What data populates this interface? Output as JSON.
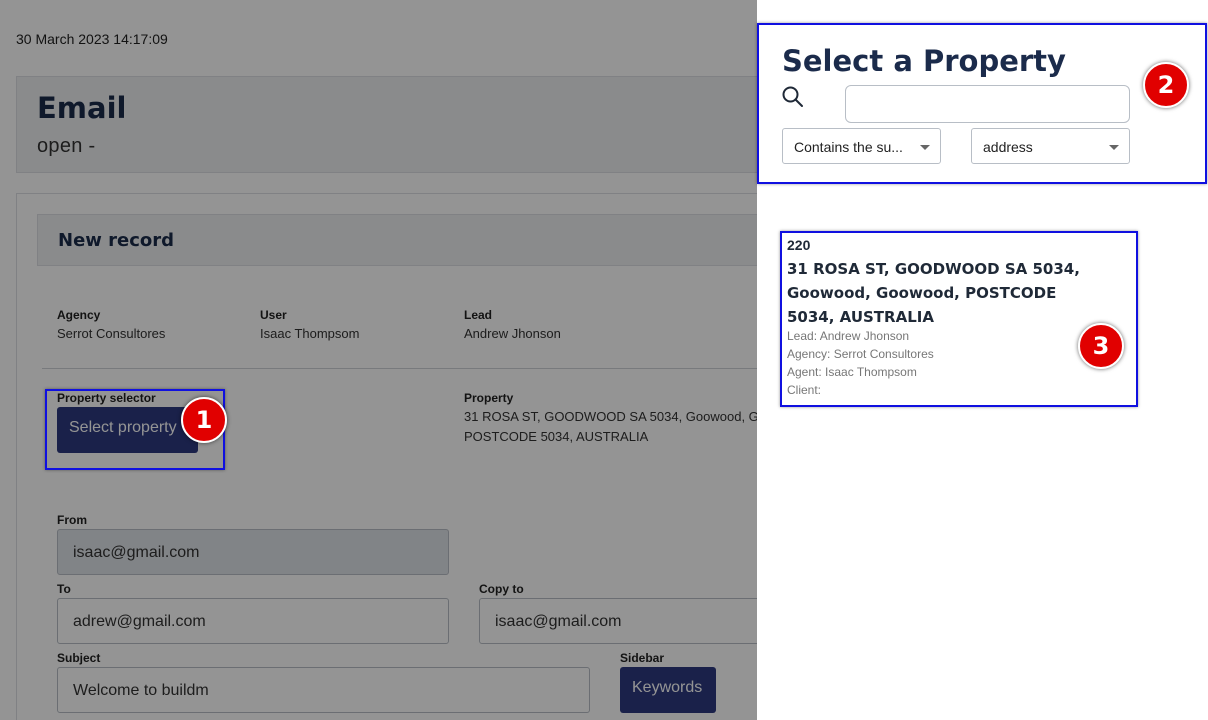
{
  "timestamp": "30 March 2023 14:17:09",
  "header": {
    "title": "Email",
    "subtitle": "open -"
  },
  "form": {
    "section_title": "New record",
    "agency": {
      "label": "Agency",
      "value": "Serrot Consultores"
    },
    "user": {
      "label": "User",
      "value": "Isaac Thompsom"
    },
    "lead": {
      "label": "Lead",
      "value": "Andrew Jhonson"
    },
    "property_selector": {
      "label": "Property selector",
      "button": "Select property"
    },
    "property": {
      "label": "Property",
      "line1": "31 ROSA ST, GOODWOOD SA 5034, Goowood, G",
      "line2": "POSTCODE 5034, AUSTRALIA"
    },
    "from": {
      "label": "From",
      "value": "isaac@gmail.com"
    },
    "to": {
      "label": "To",
      "value": "adrew@gmail.com"
    },
    "copy_to": {
      "label": "Copy to",
      "value": "isaac@gmail.com"
    },
    "subject": {
      "label": "Subject",
      "value": "Welcome to buildm"
    },
    "sidebar": {
      "label": "Sidebar",
      "button": "Keywords"
    }
  },
  "panel": {
    "title": "Select a Property",
    "search": {
      "value": "",
      "placeholder": ""
    },
    "match_mode": "Contains the su...",
    "field": "address",
    "results": [
      {
        "id": "220",
        "address": "31 ROSA ST, GOODWOOD SA 5034, Goowood, Goowood, POSTCODE 5034, AUSTRALIA",
        "lead": "Lead: Andrew Jhonson",
        "agency": "Agency: Serrot Consultores",
        "agent": "Agent: Isaac Thompsom",
        "client": "Client:"
      }
    ]
  },
  "annotations": [
    "1",
    "2",
    "3"
  ],
  "colors": {
    "primary_button": "#2d3a80",
    "heading": "#1b2b4b",
    "annotation_box": "#1010e0",
    "annotation_badge": "#e10000"
  },
  "icons": {
    "search": "search-icon",
    "dropdown": "caret-down-icon"
  }
}
